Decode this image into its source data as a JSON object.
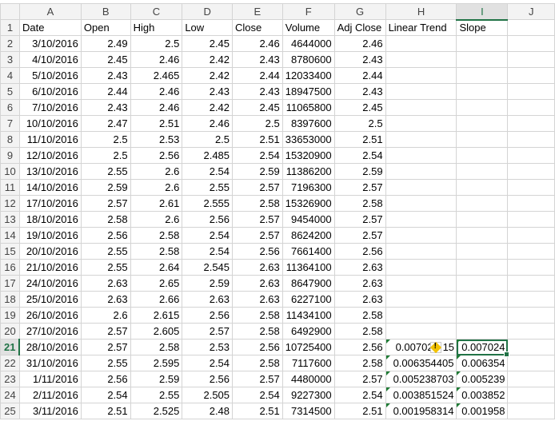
{
  "columns": [
    "A",
    "B",
    "C",
    "D",
    "E",
    "F",
    "G",
    "H",
    "I",
    "J"
  ],
  "headers": [
    "Date",
    "Open",
    "High",
    "Low",
    "Close",
    "Volume",
    "Adj Close",
    "Linear Trend",
    "Slope"
  ],
  "rows": [
    [
      "3/10/2016",
      "2.49",
      "2.5",
      "2.45",
      "2.46",
      "4644000",
      "2.46",
      "",
      ""
    ],
    [
      "4/10/2016",
      "2.45",
      "2.46",
      "2.42",
      "2.43",
      "8780600",
      "2.43",
      "",
      ""
    ],
    [
      "5/10/2016",
      "2.43",
      "2.465",
      "2.42",
      "2.44",
      "12033400",
      "2.44",
      "",
      ""
    ],
    [
      "6/10/2016",
      "2.44",
      "2.46",
      "2.43",
      "2.43",
      "18947500",
      "2.43",
      "",
      ""
    ],
    [
      "7/10/2016",
      "2.43",
      "2.46",
      "2.42",
      "2.45",
      "11065800",
      "2.45",
      "",
      ""
    ],
    [
      "10/10/2016",
      "2.47",
      "2.51",
      "2.46",
      "2.5",
      "8397600",
      "2.5",
      "",
      ""
    ],
    [
      "11/10/2016",
      "2.5",
      "2.53",
      "2.5",
      "2.51",
      "33653000",
      "2.51",
      "",
      ""
    ],
    [
      "12/10/2016",
      "2.5",
      "2.56",
      "2.485",
      "2.54",
      "15320900",
      "2.54",
      "",
      ""
    ],
    [
      "13/10/2016",
      "2.55",
      "2.6",
      "2.54",
      "2.59",
      "11386200",
      "2.59",
      "",
      ""
    ],
    [
      "14/10/2016",
      "2.59",
      "2.6",
      "2.55",
      "2.57",
      "7196300",
      "2.57",
      "",
      ""
    ],
    [
      "17/10/2016",
      "2.57",
      "2.61",
      "2.555",
      "2.58",
      "15326900",
      "2.58",
      "",
      ""
    ],
    [
      "18/10/2016",
      "2.58",
      "2.6",
      "2.56",
      "2.57",
      "9454000",
      "2.57",
      "",
      ""
    ],
    [
      "19/10/2016",
      "2.56",
      "2.58",
      "2.54",
      "2.57",
      "8624200",
      "2.57",
      "",
      ""
    ],
    [
      "20/10/2016",
      "2.55",
      "2.58",
      "2.54",
      "2.56",
      "7661400",
      "2.56",
      "",
      ""
    ],
    [
      "21/10/2016",
      "2.55",
      "2.64",
      "2.545",
      "2.63",
      "11364100",
      "2.63",
      "",
      ""
    ],
    [
      "24/10/2016",
      "2.63",
      "2.65",
      "2.59",
      "2.63",
      "8647900",
      "2.63",
      "",
      ""
    ],
    [
      "25/10/2016",
      "2.63",
      "2.66",
      "2.63",
      "2.63",
      "6227100",
      "2.63",
      "",
      ""
    ],
    [
      "26/10/2016",
      "2.6",
      "2.615",
      "2.56",
      "2.58",
      "11434100",
      "2.58",
      "",
      ""
    ],
    [
      "27/10/2016",
      "2.57",
      "2.605",
      "2.57",
      "2.58",
      "6492900",
      "2.58",
      "",
      ""
    ],
    [
      "28/10/2016",
      "2.57",
      "2.58",
      "2.53",
      "2.56",
      "10725400",
      "2.56",
      "0.00702",
      "0.007024"
    ],
    [
      "31/10/2016",
      "2.55",
      "2.595",
      "2.54",
      "2.58",
      "7117600",
      "2.58",
      "0.006354405",
      "0.006354"
    ],
    [
      "1/11/2016",
      "2.56",
      "2.59",
      "2.56",
      "2.57",
      "4480000",
      "2.57",
      "0.005238703",
      "0.005239"
    ],
    [
      "2/11/2016",
      "2.54",
      "2.55",
      "2.505",
      "2.54",
      "9227300",
      "2.54",
      "0.003851524",
      "0.003852"
    ],
    [
      "3/11/2016",
      "2.51",
      "2.525",
      "2.48",
      "2.51",
      "7314500",
      "2.51",
      "0.001958314",
      "0.001958"
    ]
  ],
  "h21_overflow_tail": "15",
  "selected": {
    "column": "I",
    "row": 21
  }
}
